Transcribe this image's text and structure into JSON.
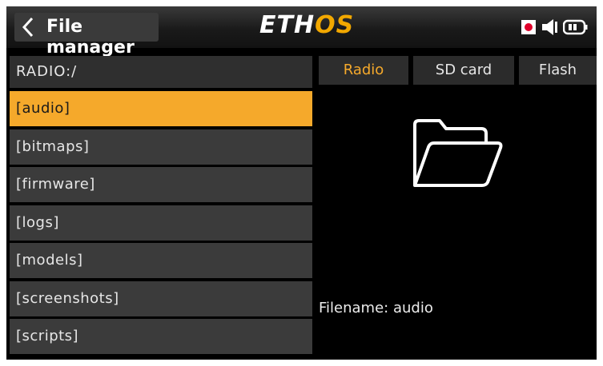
{
  "header": {
    "title": "File manager",
    "logo_part1": "ETH",
    "logo_part2": "OS",
    "brand_color": "#f2a800"
  },
  "path": "RADIO:/",
  "list": {
    "items": [
      {
        "label": "[audio]",
        "selected": true
      },
      {
        "label": "[bitmaps]",
        "selected": false
      },
      {
        "label": "[firmware]",
        "selected": false
      },
      {
        "label": "[logs]",
        "selected": false
      },
      {
        "label": "[models]",
        "selected": false
      },
      {
        "label": "[screenshots]",
        "selected": false
      },
      {
        "label": "[scripts]",
        "selected": false
      }
    ]
  },
  "tabs": [
    {
      "label": "Radio",
      "active": true
    },
    {
      "label": "SD card",
      "active": false
    },
    {
      "label": "Flash",
      "active": false
    }
  ],
  "preview": {
    "icon": "folder-icon",
    "filename_text": "Filename: audio"
  },
  "colors": {
    "selection": "#f5a92b",
    "record_dot": "#e0002a"
  }
}
